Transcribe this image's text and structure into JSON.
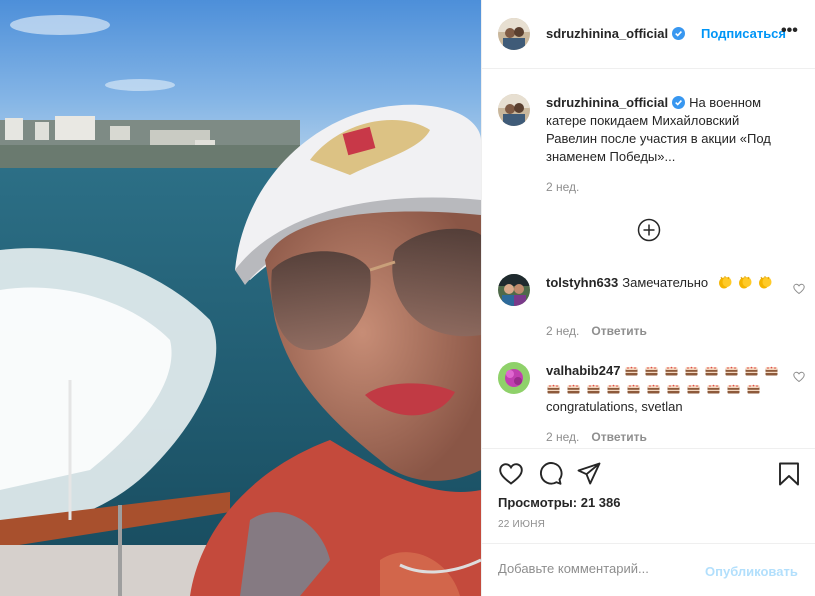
{
  "header": {
    "username": "sdruzhinina_official",
    "follow_label": "Подписаться",
    "more_label": "•••",
    "avatar_icon": "user-avatar-icon",
    "verified_icon": "verified-badge-icon"
  },
  "caption": {
    "username": "sdruzhinina_official",
    "text": "На военном катере покидаем Михайловский Равелин после участия в акции «Под знаменем Победы»...",
    "time": "2 нед."
  },
  "load_more_icon": "plus-circle-icon",
  "comments": [
    {
      "username": "tolstyhn633",
      "text": "Замечательно",
      "emoji_icon": "clapping-hands-icon",
      "emoji_count": 3,
      "time": "2 нед.",
      "reply_label": "Ответить",
      "like_icon": "heart-outline-icon"
    },
    {
      "username": "valhabib247",
      "text": "congratulations, svetlan",
      "emoji_icon": "cake-icon",
      "emoji_count": 19,
      "time": "2 нед.",
      "reply_label": "Ответить",
      "like_icon": "heart-outline-icon"
    }
  ],
  "actions": {
    "like_icon": "heart-icon",
    "comment_icon": "comment-icon",
    "share_icon": "paper-plane-icon",
    "save_icon": "bookmark-icon",
    "views_label": "Просмотры:",
    "views_count": "21 386",
    "date": "22 июня"
  },
  "add_comment": {
    "placeholder": "Добавьте комментарий...",
    "publish_label": "Опубликовать"
  },
  "colors": {
    "accent": "#0095f6",
    "publish_disabled": "#b2dffc",
    "secondary_text": "#8e8e8e",
    "border": "#efefef"
  }
}
